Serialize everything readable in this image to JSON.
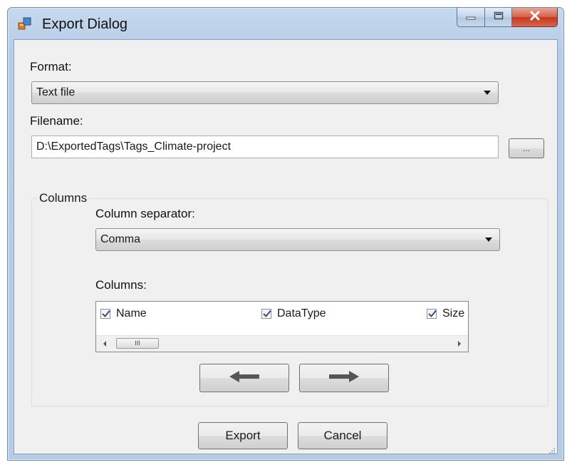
{
  "window": {
    "title": "Export Dialog"
  },
  "format": {
    "label": "Format:",
    "selected": "Text file"
  },
  "filename": {
    "label": "Filename:",
    "value": "D:\\ExportedTags\\Tags_Climate-project",
    "browse_label": "..."
  },
  "columns_group": {
    "title": "Columns",
    "separator_label": "Column separator:",
    "separator_selected": "Comma",
    "list_label": "Columns:",
    "items": [
      {
        "label": "Name",
        "checked": true
      },
      {
        "label": "DataType",
        "checked": true
      },
      {
        "label": "Size",
        "checked": true
      }
    ],
    "scroll_thumb": "III"
  },
  "buttons": {
    "export": "Export",
    "cancel": "Cancel"
  },
  "icons": {
    "app": "export-dialog-icon",
    "move_left": "arrow-left-icon",
    "move_right": "arrow-right-icon"
  },
  "colors": {
    "titlebar": "#b9cee6",
    "close_button": "#c7381b",
    "client": "#f0f0f0"
  }
}
